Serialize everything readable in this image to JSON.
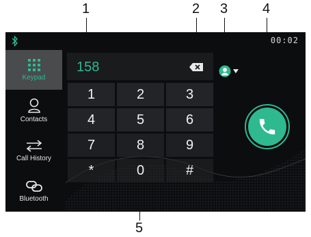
{
  "callouts": [
    "1",
    "2",
    "3",
    "4",
    "5"
  ],
  "status": {
    "clock": "00:02"
  },
  "sidebar": {
    "items": [
      {
        "label": "Keypad",
        "icon": "keypad-icon"
      },
      {
        "label": "Contacts",
        "icon": "contact-icon"
      },
      {
        "label": "Call History",
        "icon": "call-history-icon"
      },
      {
        "label": "Bluetooth",
        "icon": "bluetooth-link-icon"
      }
    ]
  },
  "dialpad": {
    "number": "158",
    "keys": [
      "1",
      "2",
      "3",
      "4",
      "5",
      "6",
      "7",
      "8",
      "9",
      "*",
      "0",
      "#"
    ]
  },
  "colors": {
    "accent": "#2fb98f",
    "background": "#0c0d0f",
    "key": "#232427"
  }
}
